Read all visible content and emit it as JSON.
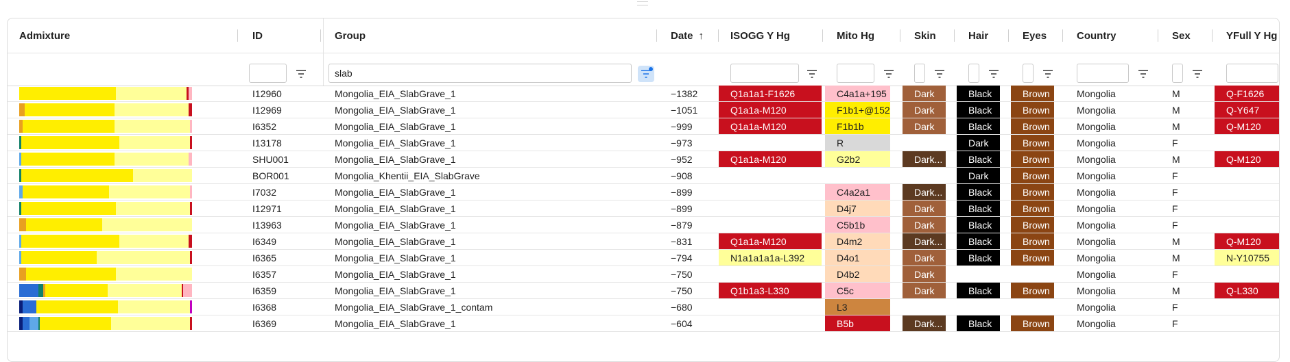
{
  "columns": {
    "admixture": "Admixture",
    "id": "ID",
    "group": "Group",
    "date": "Date",
    "date_sort_icon": "arrow-up-icon",
    "isogg": "ISOGG Y Hg",
    "mito": "Mito Hg",
    "skin": "Skin",
    "hair": "Hair",
    "eyes": "Eyes",
    "country": "Country",
    "sex": "Sex",
    "yfull": "YFull Y Hg"
  },
  "filters": {
    "group_value": "slab",
    "filter_icon": "filter-icon"
  },
  "colors": {
    "ydna_red": "#c8101e",
    "ydna_yellow": "#ffff99",
    "mito_pink": "#ffc0cb",
    "mito_yellow": "#ffee00",
    "mito_lightyellow": "#ffff99",
    "mito_gray": "#d9d9d9",
    "mito_peach": "#ffdab9",
    "mito_copper": "#cd853f",
    "mito_red": "#c8101e",
    "skin_dark": "#a0603a",
    "skin_darker": "#5c3a21",
    "hair_black": "#000000",
    "eyes_brown": "#8b4513",
    "adm_yellow": "#ffee00",
    "adm_lightyellow": "#ffff99",
    "adm_orange": "#e8a020",
    "adm_red": "#c8101e",
    "adm_pink": "#ffb6c1",
    "adm_blue": "#2a6dd4",
    "adm_lightblue": "#5fa8e8",
    "adm_navy": "#0a1f7a",
    "adm_teal": "#13806a",
    "adm_purple": "#c000c0"
  },
  "rows": [
    {
      "id": "I12960",
      "group": "Mongolia_EIA_SlabGrave_1",
      "date": "−1382",
      "isogg": "Q1a1a1-F1626",
      "isogg_color": "red",
      "mito": "C4a1a+195",
      "mito_color": "pink",
      "skin": "Dark",
      "skin_color": "dark",
      "hair": "Black",
      "eyes": "Brown",
      "country": "Mongolia",
      "sex": "M",
      "yfull": "Q-F1626",
      "yfull_color": "red",
      "admixture": [
        {
          "c": "adm_yellow",
          "w": 0.56
        },
        {
          "c": "adm_lightyellow",
          "w": 0.41
        },
        {
          "c": "adm_red",
          "w": 0.01
        },
        {
          "c": "adm_pink",
          "w": 0.02
        }
      ]
    },
    {
      "id": "I12969",
      "group": "Mongolia_EIA_SlabGrave_1",
      "date": "−1051",
      "isogg": "Q1a1a-M120",
      "isogg_color": "red",
      "mito": "F1b1+@152",
      "mito_color": "yellow",
      "skin": "Dark",
      "skin_color": "dark",
      "hair": "Black",
      "eyes": "Brown",
      "country": "Mongolia",
      "sex": "M",
      "yfull": "Q-Y647",
      "yfull_color": "red",
      "admixture": [
        {
          "c": "adm_orange",
          "w": 0.03
        },
        {
          "c": "adm_yellow",
          "w": 0.52
        },
        {
          "c": "adm_lightyellow",
          "w": 0.43
        },
        {
          "c": "adm_red",
          "w": 0.02
        }
      ]
    },
    {
      "id": "I6352",
      "group": "Mongolia_EIA_SlabGrave_1",
      "date": "−999",
      "isogg": "Q1a1a-M120",
      "isogg_color": "red",
      "mito": "F1b1b",
      "mito_color": "yellow",
      "skin": "Dark",
      "skin_color": "dark",
      "hair": "Black",
      "eyes": "Brown",
      "country": "Mongolia",
      "sex": "M",
      "yfull": "Q-M120",
      "yfull_color": "red",
      "admixture": [
        {
          "c": "adm_orange",
          "w": 0.02
        },
        {
          "c": "adm_yellow",
          "w": 0.53
        },
        {
          "c": "adm_lightyellow",
          "w": 0.44
        },
        {
          "c": "adm_pink",
          "w": 0.01
        }
      ]
    },
    {
      "id": "I13178",
      "group": "Mongolia_EIA_SlabGrave_1",
      "date": "−973",
      "isogg": "",
      "isogg_color": "",
      "mito": "R",
      "mito_color": "gray",
      "skin": "",
      "skin_color": "",
      "hair": "Dark",
      "eyes": "Brown",
      "country": "Mongolia",
      "sex": "F",
      "yfull": "",
      "yfull_color": "",
      "admixture": [
        {
          "c": "adm_teal",
          "w": 0.01
        },
        {
          "c": "adm_yellow",
          "w": 0.57
        },
        {
          "c": "adm_lightyellow",
          "w": 0.41
        },
        {
          "c": "adm_red",
          "w": 0.01
        }
      ]
    },
    {
      "id": "SHU001",
      "group": "Mongolia_EIA_SlabGrave_1",
      "date": "−952",
      "isogg": "Q1a1a-M120",
      "isogg_color": "red",
      "mito": "G2b2",
      "mito_color": "lightyellow",
      "skin": "Dark...",
      "skin_color": "darker",
      "hair": "Black",
      "eyes": "Brown",
      "country": "Mongolia",
      "sex": "M",
      "yfull": "Q-M120",
      "yfull_color": "red",
      "admixture": [
        {
          "c": "adm_lightblue",
          "w": 0.01
        },
        {
          "c": "adm_yellow",
          "w": 0.54
        },
        {
          "c": "adm_lightyellow",
          "w": 0.43
        },
        {
          "c": "adm_pink",
          "w": 0.02
        }
      ]
    },
    {
      "id": "BOR001",
      "group": "Mongolia_Khentii_EIA_SlabGrave",
      "date": "−908",
      "isogg": "",
      "isogg_color": "",
      "mito": "",
      "mito_color": "",
      "skin": "",
      "skin_color": "",
      "hair": "Dark",
      "eyes": "Brown",
      "country": "Mongolia",
      "sex": "F",
      "yfull": "",
      "yfull_color": "",
      "admixture": [
        {
          "c": "adm_teal",
          "w": 0.01
        },
        {
          "c": "adm_yellow",
          "w": 0.65
        },
        {
          "c": "adm_lightyellow",
          "w": 0.34
        }
      ]
    },
    {
      "id": "I7032",
      "group": "Mongolia_EIA_SlabGrave_1",
      "date": "−899",
      "isogg": "",
      "isogg_color": "",
      "mito": "C4a2a1",
      "mito_color": "pink",
      "skin": "Dark...",
      "skin_color": "darker",
      "hair": "Black",
      "eyes": "Brown",
      "country": "Mongolia",
      "sex": "F",
      "yfull": "",
      "yfull_color": "",
      "admixture": [
        {
          "c": "adm_lightblue",
          "w": 0.02
        },
        {
          "c": "adm_yellow",
          "w": 0.5
        },
        {
          "c": "adm_lightyellow",
          "w": 0.47
        },
        {
          "c": "adm_pink",
          "w": 0.01
        }
      ]
    },
    {
      "id": "I12971",
      "group": "Mongolia_EIA_SlabGrave_1",
      "date": "−899",
      "isogg": "",
      "isogg_color": "",
      "mito": "D4j7",
      "mito_color": "peach",
      "skin": "Dark",
      "skin_color": "dark",
      "hair": "Black",
      "eyes": "Brown",
      "country": "Mongolia",
      "sex": "F",
      "yfull": "",
      "yfull_color": "",
      "admixture": [
        {
          "c": "adm_teal",
          "w": 0.01
        },
        {
          "c": "adm_yellow",
          "w": 0.55
        },
        {
          "c": "adm_lightyellow",
          "w": 0.43
        },
        {
          "c": "adm_red",
          "w": 0.01
        }
      ]
    },
    {
      "id": "I13963",
      "group": "Mongolia_EIA_SlabGrave_1",
      "date": "−879",
      "isogg": "",
      "isogg_color": "",
      "mito": "C5b1b",
      "mito_color": "pink",
      "skin": "Dark",
      "skin_color": "dark",
      "hair": "Black",
      "eyes": "Brown",
      "country": "Mongolia",
      "sex": "F",
      "yfull": "",
      "yfull_color": "",
      "admixture": [
        {
          "c": "adm_orange",
          "w": 0.04
        },
        {
          "c": "adm_yellow",
          "w": 0.44
        },
        {
          "c": "adm_lightyellow",
          "w": 0.52
        }
      ]
    },
    {
      "id": "I6349",
      "group": "Mongolia_EIA_SlabGrave_1",
      "date": "−831",
      "isogg": "Q1a1a-M120",
      "isogg_color": "red",
      "mito": "D4m2",
      "mito_color": "peach",
      "skin": "Dark...",
      "skin_color": "darker",
      "hair": "Black",
      "eyes": "Brown",
      "country": "Mongolia",
      "sex": "M",
      "yfull": "Q-M120",
      "yfull_color": "red",
      "admixture": [
        {
          "c": "adm_lightblue",
          "w": 0.01
        },
        {
          "c": "adm_yellow",
          "w": 0.57
        },
        {
          "c": "adm_lightyellow",
          "w": 0.4
        },
        {
          "c": "adm_red",
          "w": 0.02
        }
      ]
    },
    {
      "id": "I6365",
      "group": "Mongolia_EIA_SlabGrave_1",
      "date": "−794",
      "isogg": "N1a1a1a1a-L392",
      "isogg_color": "lightyellow",
      "mito": "D4o1",
      "mito_color": "peach",
      "skin": "Dark",
      "skin_color": "dark",
      "hair": "Black",
      "eyes": "Brown",
      "country": "Mongolia",
      "sex": "M",
      "yfull": "N-Y10755",
      "yfull_color": "lightyellow",
      "admixture": [
        {
          "c": "adm_lightblue",
          "w": 0.01
        },
        {
          "c": "adm_yellow",
          "w": 0.44
        },
        {
          "c": "adm_lightyellow",
          "w": 0.54
        },
        {
          "c": "adm_red",
          "w": 0.01
        }
      ]
    },
    {
      "id": "I6357",
      "group": "Mongolia_EIA_SlabGrave_1",
      "date": "−750",
      "isogg": "",
      "isogg_color": "",
      "mito": "D4b2",
      "mito_color": "peach",
      "skin": "Dark",
      "skin_color": "dark",
      "hair": "",
      "eyes": "",
      "country": "Mongolia",
      "sex": "F",
      "yfull": "",
      "yfull_color": "",
      "admixture": [
        {
          "c": "adm_orange",
          "w": 0.04
        },
        {
          "c": "adm_yellow",
          "w": 0.52
        },
        {
          "c": "adm_lightyellow",
          "w": 0.44
        }
      ]
    },
    {
      "id": "I6359",
      "group": "Mongolia_EIA_SlabGrave_1",
      "date": "−750",
      "isogg": "Q1b1a3-L330",
      "isogg_color": "red",
      "mito": "C5c",
      "mito_color": "pink",
      "skin": "Dark",
      "skin_color": "dark",
      "hair": "Black",
      "eyes": "Brown",
      "country": "Mongolia",
      "sex": "M",
      "yfull": "Q-L330",
      "yfull_color": "red",
      "admixture": [
        {
          "c": "adm_blue",
          "w": 0.11
        },
        {
          "c": "adm_teal",
          "w": 0.03
        },
        {
          "c": "adm_orange",
          "w": 0.01
        },
        {
          "c": "adm_yellow",
          "w": 0.36
        },
        {
          "c": "adm_lightyellow",
          "w": 0.43
        },
        {
          "c": "adm_red",
          "w": 0.01
        },
        {
          "c": "adm_pink",
          "w": 0.05
        }
      ]
    },
    {
      "id": "I6368",
      "group": "Mongolia_EIA_SlabGrave_1_contam",
      "date": "−680",
      "isogg": "",
      "isogg_color": "",
      "mito": "L3",
      "mito_color": "copper",
      "skin": "",
      "skin_color": "",
      "hair": "",
      "eyes": "",
      "country": "Mongolia",
      "sex": "F",
      "yfull": "",
      "yfull_color": "",
      "admixture": [
        {
          "c": "adm_navy",
          "w": 0.02
        },
        {
          "c": "adm_blue",
          "w": 0.08
        },
        {
          "c": "adm_yellow",
          "w": 0.47
        },
        {
          "c": "adm_lightyellow",
          "w": 0.42
        },
        {
          "c": "adm_purple",
          "w": 0.01
        }
      ]
    },
    {
      "id": "I6369",
      "group": "Mongolia_EIA_SlabGrave_1",
      "date": "−604",
      "isogg": "",
      "isogg_color": "",
      "mito": "B5b",
      "mito_color": "red",
      "skin": "Dark...",
      "skin_color": "darker",
      "hair": "Black",
      "eyes": "Brown",
      "country": "Mongolia",
      "sex": "F",
      "yfull": "",
      "yfull_color": "",
      "admixture": [
        {
          "c": "adm_navy",
          "w": 0.02
        },
        {
          "c": "adm_blue",
          "w": 0.04
        },
        {
          "c": "adm_lightblue",
          "w": 0.05
        },
        {
          "c": "adm_teal",
          "w": 0.01
        },
        {
          "c": "adm_yellow",
          "w": 0.41
        },
        {
          "c": "adm_lightyellow",
          "w": 0.46
        },
        {
          "c": "adm_red",
          "w": 0.01
        }
      ]
    }
  ]
}
